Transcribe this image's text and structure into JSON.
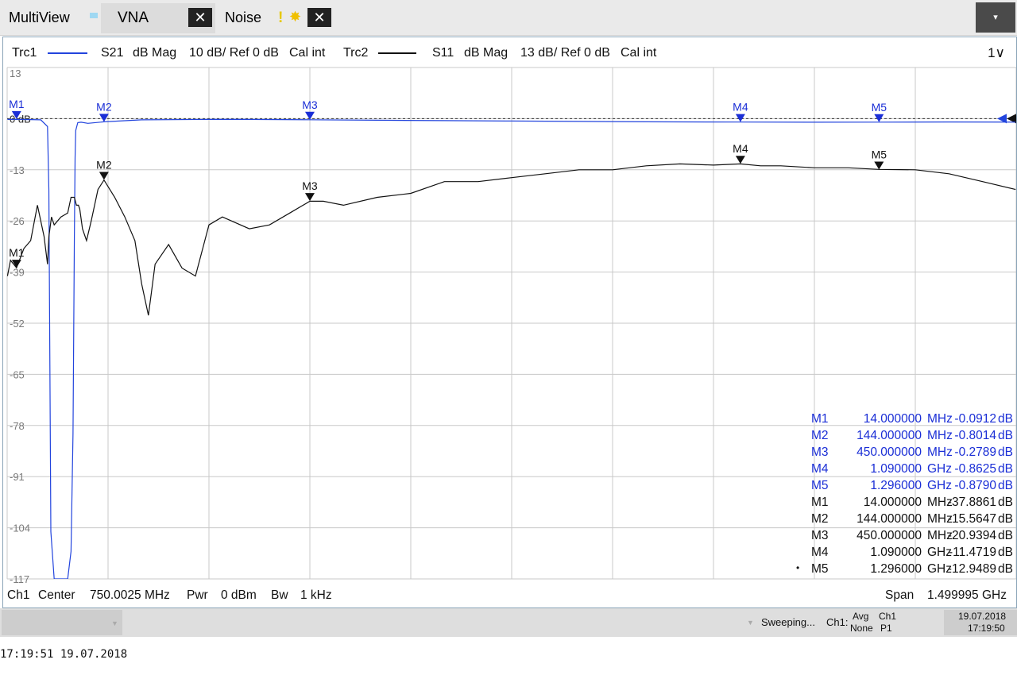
{
  "tabs": {
    "multiview": "MultiView",
    "vna": "VNA",
    "noise": "Noise",
    "close_glyph": "✕",
    "noise_warning": "!",
    "noise_star": "✸",
    "dropdown_glyph": "▾"
  },
  "trace_header": {
    "trc1": {
      "name": "Trc1",
      "param": "S21",
      "format": "dB Mag",
      "scale": "10 dB/ Ref 0 dB",
      "cal": "Cal int",
      "color": "#2244dd"
    },
    "trc2": {
      "name": "Trc2",
      "param": "S11",
      "format": "dB Mag",
      "scale": "13 dB/ Ref 0 dB",
      "cal": "Cal int",
      "color": "#111111"
    },
    "window": "1",
    "window_glyph": "∨"
  },
  "chart_data": {
    "type": "line",
    "y_tick_labels": [
      "13",
      "0 dB",
      "-13",
      "-26",
      "-39",
      "-52",
      "-65",
      "-78",
      "-91",
      "-104",
      "-117"
    ],
    "x_range_ghz": [
      5.25e-05,
      1.4999525
    ],
    "ylim": [
      -117,
      13
    ],
    "grid": true,
    "series": [
      {
        "name": "Trc1",
        "color": "#2244dd",
        "x_ghz": [
          0.0005,
          0.02,
          0.05,
          0.06,
          0.062,
          0.065,
          0.07,
          0.09,
          0.095,
          0.098,
          0.1,
          0.101,
          0.102,
          0.105,
          0.11,
          0.12,
          0.144,
          0.2,
          0.3,
          0.35,
          0.45,
          0.55,
          0.65,
          0.75,
          0.85,
          0.95,
          1.09,
          1.2,
          1.296,
          1.4,
          1.499
        ],
        "y_db": [
          -0.2,
          -0.2,
          -0.3,
          -2,
          -18,
          -105,
          -117,
          -117,
          -110,
          -80,
          -30,
          -10,
          -3,
          -1,
          -0.9,
          -1.2,
          -0.8,
          -0.3,
          -0.2,
          -0.2,
          -0.28,
          -0.4,
          -0.5,
          -0.6,
          -0.7,
          -0.8,
          -0.86,
          -0.9,
          -0.88,
          -0.85,
          -0.88
        ]
      },
      {
        "name": "Trc2",
        "color": "#111111",
        "x_ghz": [
          0.0005,
          0.005,
          0.014,
          0.025,
          0.035,
          0.045,
          0.055,
          0.06,
          0.062,
          0.066,
          0.07,
          0.08,
          0.09,
          0.095,
          0.1,
          0.103,
          0.106,
          0.108,
          0.112,
          0.118,
          0.125,
          0.135,
          0.144,
          0.16,
          0.175,
          0.19,
          0.2,
          0.21,
          0.22,
          0.24,
          0.26,
          0.28,
          0.3,
          0.32,
          0.36,
          0.39,
          0.42,
          0.45,
          0.47,
          0.5,
          0.55,
          0.6,
          0.65,
          0.7,
          0.75,
          0.8,
          0.85,
          0.9,
          0.95,
          1.0,
          1.05,
          1.09,
          1.12,
          1.15,
          1.2,
          1.25,
          1.296,
          1.35,
          1.4,
          1.45,
          1.499
        ],
        "y_db": [
          -40,
          -36,
          -37.9,
          -33,
          -31,
          -22,
          -30,
          -37,
          -30,
          -25,
          -27,
          -25,
          -24,
          -20,
          -20,
          -22,
          -22,
          -23,
          -28,
          -31,
          -26,
          -18,
          -15.6,
          -20,
          -25,
          -31,
          -42,
          -50,
          -37,
          -32,
          -38,
          -40,
          -27,
          -25,
          -28,
          -27,
          -24,
          -21,
          -21,
          -22,
          -20,
          -19,
          -16,
          -16,
          -15,
          -14,
          -13,
          -13,
          -12,
          -11.5,
          -11.8,
          -11.5,
          -12,
          -12,
          -12.5,
          -12.5,
          -12.9,
          -13,
          -14,
          -16,
          -18
        ]
      }
    ],
    "markers_trc1": [
      {
        "label": "M1",
        "x_ghz": 0.014,
        "y_db": -0.0912
      },
      {
        "label": "M2",
        "x_ghz": 0.144,
        "y_db": -0.8014
      },
      {
        "label": "M3",
        "x_ghz": 0.45,
        "y_db": -0.2789
      },
      {
        "label": "M4",
        "x_ghz": 1.09,
        "y_db": -0.8625
      },
      {
        "label": "M5",
        "x_ghz": 1.296,
        "y_db": -0.879
      }
    ],
    "markers_trc2": [
      {
        "label": "M1",
        "x_ghz": 0.014,
        "y_db": -37.8861
      },
      {
        "label": "M2",
        "x_ghz": 0.144,
        "y_db": -15.5647
      },
      {
        "label": "M3",
        "x_ghz": 0.45,
        "y_db": -20.9394
      },
      {
        "label": "M4",
        "x_ghz": 1.09,
        "y_db": -11.4719
      },
      {
        "label": "M5",
        "x_ghz": 1.296,
        "y_db": -12.9489
      }
    ]
  },
  "marker_table": [
    {
      "label": "M1",
      "freq": "14.000000",
      "unit": "MHz",
      "value": "-0.0912",
      "vunit": "dB",
      "trace": "Trc1"
    },
    {
      "label": "M2",
      "freq": "144.000000",
      "unit": "MHz",
      "value": "-0.8014",
      "vunit": "dB",
      "trace": "Trc1"
    },
    {
      "label": "M3",
      "freq": "450.000000",
      "unit": "MHz",
      "value": "-0.2789",
      "vunit": "dB",
      "trace": "Trc1"
    },
    {
      "label": "M4",
      "freq": "1.090000",
      "unit": "GHz",
      "value": "-0.8625",
      "vunit": "dB",
      "trace": "Trc1"
    },
    {
      "label": "M5",
      "freq": "1.296000",
      "unit": "GHz",
      "value": "-0.8790",
      "vunit": "dB",
      "trace": "Trc1"
    },
    {
      "label": "M1",
      "freq": "14.000000",
      "unit": "MHz",
      "value": "-37.8861",
      "vunit": "dB",
      "trace": "Trc2"
    },
    {
      "label": "M2",
      "freq": "144.000000",
      "unit": "MHz",
      "value": "-15.5647",
      "vunit": "dB",
      "trace": "Trc2"
    },
    {
      "label": "M3",
      "freq": "450.000000",
      "unit": "MHz",
      "value": "-20.9394",
      "vunit": "dB",
      "trace": "Trc2"
    },
    {
      "label": "M4",
      "freq": "1.090000",
      "unit": "GHz",
      "value": "-11.4719",
      "vunit": "dB",
      "trace": "Trc2"
    },
    {
      "label": "M5",
      "freq": "1.296000",
      "unit": "GHz",
      "value": "-12.9489",
      "vunit": "dB",
      "trace": "Trc2",
      "active": true
    }
  ],
  "active_marker_glyph": "•",
  "channel": {
    "name": "Ch1",
    "center_label": "Center",
    "center_value": "750.0025 MHz",
    "pwr_label": "Pwr",
    "pwr_value": "0 dBm",
    "bw_label": "Bw",
    "bw_value": "1 kHz",
    "span_label": "Span",
    "span_value": "1.499995 GHz"
  },
  "statusbar": {
    "state": "Sweeping...",
    "ch": "Ch1:",
    "avg_label": "Avg",
    "avg_value": "None",
    "ch_label": "Ch1",
    "ch_value": "P1",
    "date": "19.07.2018",
    "time": "17:19:50"
  },
  "footer_timestamp": "17:19:51  19.07.2018"
}
